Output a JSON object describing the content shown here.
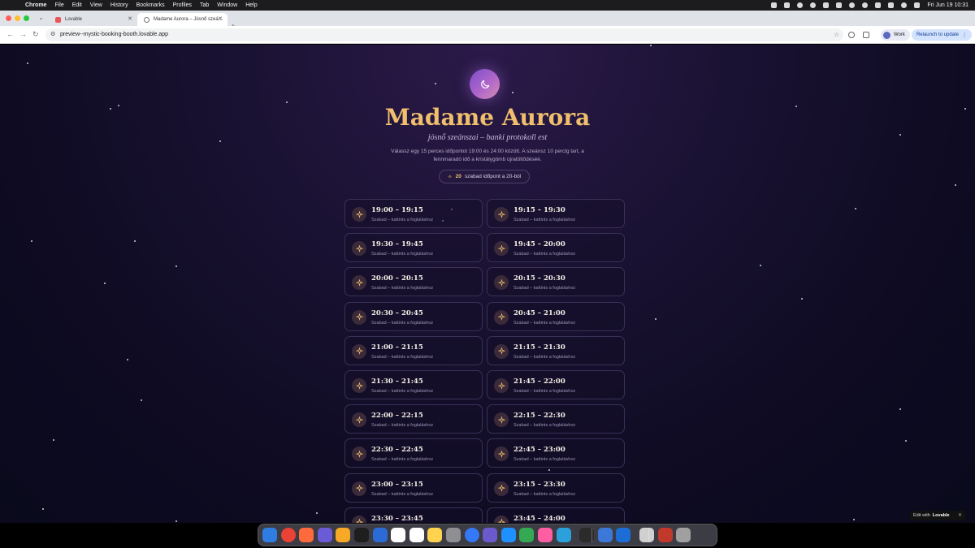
{
  "menubar": {
    "app": "Chrome",
    "items": [
      "File",
      "Edit",
      "View",
      "History",
      "Bookmarks",
      "Profiles",
      "Tab",
      "Window",
      "Help"
    ],
    "clock": "Fri Jun 19  10:31"
  },
  "browser": {
    "tabs": [
      {
        "title": "Lovable",
        "favicon_color": "#e8555b"
      },
      {
        "title": "Madame Aurora – Jósnő szeá…",
        "favicon_color": "#555555"
      }
    ],
    "url": "preview--mystic-booking-booth.lovable.app",
    "profile": "Work",
    "relaunch": "Relaunch to update"
  },
  "page": {
    "title": "Madame Aurora",
    "subtitle": "jósnő szeánszai – banki protokoll est",
    "description": "Válassz egy 15 perces időpontot 19:00 és 24:00 között. A szeánsz 10 perclg tart, a fennmaradó idő a kristálygömb újratöltődéséé.",
    "available_count": "20",
    "available_text": "szabad időpont a 20-ból",
    "slot_status": "Szabad – kattints a foglaláshoz",
    "slots": [
      "19:00 – 19:15",
      "19:15 – 19:30",
      "19:30 – 19:45",
      "19:45 – 20:00",
      "20:00 – 20:15",
      "20:15 – 20:30",
      "20:30 – 20:45",
      "20:45 – 21:00",
      "21:00 – 21:15",
      "21:15 – 21:30",
      "21:30 – 21:45",
      "21:45 – 22:00",
      "22:00 – 22:15",
      "22:15 – 22:30",
      "22:30 – 22:45",
      "22:45 – 23:00",
      "23:00 – 23:15",
      "23:15 – 23:30",
      "23:30 – 23:45",
      "23:45 – 24:00"
    ],
    "edit_with": "Edit with",
    "edit_brand": "Lovable"
  },
  "colors": {
    "accent_gold": "#f0bf6d",
    "background": "#140f2c",
    "moon": "#a764d0"
  }
}
